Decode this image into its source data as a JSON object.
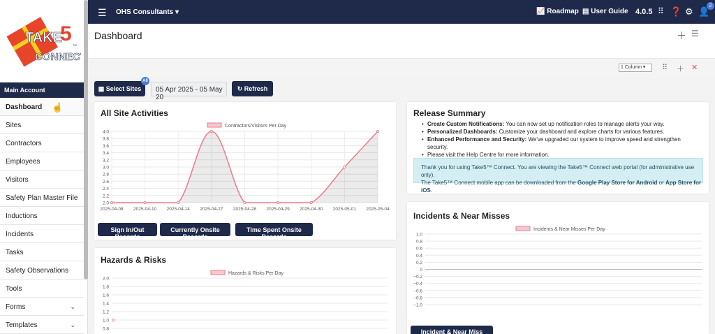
{
  "sidebar": {
    "logo": {
      "take": "TAKE",
      "five": "5",
      "tm": "TM",
      "connect": "CONNECT"
    },
    "section_label": "Main Account",
    "items": [
      {
        "label": "Dashboard",
        "chevron": false
      },
      {
        "label": "Sites",
        "chevron": false
      },
      {
        "label": "Contractors",
        "chevron": false
      },
      {
        "label": "Employees",
        "chevron": false
      },
      {
        "label": "Visitors",
        "chevron": false
      },
      {
        "label": "Safety Plan Master File",
        "chevron": false
      },
      {
        "label": "Inductions",
        "chevron": false
      },
      {
        "label": "Incidents",
        "chevron": false
      },
      {
        "label": "Tasks",
        "chevron": false
      },
      {
        "label": "Safety Observations",
        "chevron": false
      },
      {
        "label": "Tools",
        "chevron": false
      },
      {
        "label": "Forms",
        "chevron": true
      },
      {
        "label": "Templates",
        "chevron": true
      }
    ]
  },
  "topbar": {
    "org_name": "OHS Consultants",
    "roadmap_label": "Roadmap",
    "user_guide_label": "User Guide",
    "version": "4.0.5",
    "notification_count": "2"
  },
  "header": {
    "title": "Dashboard"
  },
  "toolbar": {
    "column_select": "1 Column"
  },
  "filters": {
    "select_sites_label": "Select Sites",
    "sites_badge": "All",
    "date_range": "05 Apr 2025 - 05 May 20",
    "refresh_label": "Refresh"
  },
  "activities": {
    "title": "All Site Activities",
    "buttons": [
      "Sign In/Out Records",
      "Currently Onsite Records",
      "Time Spent Onsite Records"
    ]
  },
  "hazards": {
    "title": "Hazards & Risks"
  },
  "release": {
    "title": "Release Summary",
    "items": [
      {
        "bold": "Create Custom Notifications:",
        "text": " You can now set up notification roles to manage alerts your way."
      },
      {
        "bold": "Personalized Dashboards:",
        "text": " Customize your dashboard and explore charts for various features."
      },
      {
        "bold": "Enhanced Performance and Security:",
        "text": " We've upgraded our system to improve speed and strengthen security."
      },
      {
        "bold": "",
        "text": "Please visit the Help Centre for more information."
      }
    ],
    "info_line1": "Thank you for using Take5™ Connect. You are viewing the Take5™ Connect web portal (for administrative use only).",
    "info_line2_a": "The Take5™ Connect mobile app can be downloaded from the ",
    "info_line2_b": "Google Play Store for Android",
    "info_line2_c": " or ",
    "info_line2_d": "App Store for iOS",
    "info_line2_e": "."
  },
  "incidents": {
    "title": "Incidents & Near Misses",
    "register_button": "Incident & Near Miss Register"
  },
  "colors": {
    "navy": "#1f2a4a",
    "series": "#f07a8a",
    "accent": "#4b7bd6"
  },
  "chart_data": [
    {
      "type": "area",
      "legend": "Contractors/Visitors Per Day",
      "x": [
        "2025-04-08",
        "2025-04-10",
        "2025-04-14",
        "2025-04-27",
        "2025-04-28",
        "2025-04-29",
        "2025-04-30",
        "2025-05-01",
        "2025-05-04"
      ],
      "values": [
        2.0,
        2.0,
        2.0,
        4.0,
        2.0,
        2.0,
        2.0,
        3.0,
        4.0
      ],
      "yticks": [
        "4.0",
        "3.8",
        "3.6",
        "3.4",
        "3.2",
        "3.0",
        "2.8",
        "2.6",
        "2.4",
        "2.2",
        "2.0"
      ],
      "ylim": [
        2.0,
        4.0
      ],
      "grid": true
    },
    {
      "type": "line",
      "legend": "Hazards & Risks Per Day",
      "values": [
        1.0
      ],
      "yticks": [
        "2.0",
        "1.8",
        "1.6",
        "1.4",
        "1.2",
        "1.0",
        "0.8"
      ],
      "ylim": [
        0.8,
        2.0
      ],
      "grid": true
    },
    {
      "type": "line",
      "legend": "Incidents & Near Misses Per Day",
      "values": [],
      "yticks": [
        "1.0",
        "0.8",
        "0.6",
        "0.4",
        "0.2",
        "0",
        "−0.2",
        "−0.4",
        "−0.6",
        "−0.8",
        "−1.0"
      ],
      "ylim": [
        -1.0,
        1.0
      ],
      "grid": true
    }
  ]
}
